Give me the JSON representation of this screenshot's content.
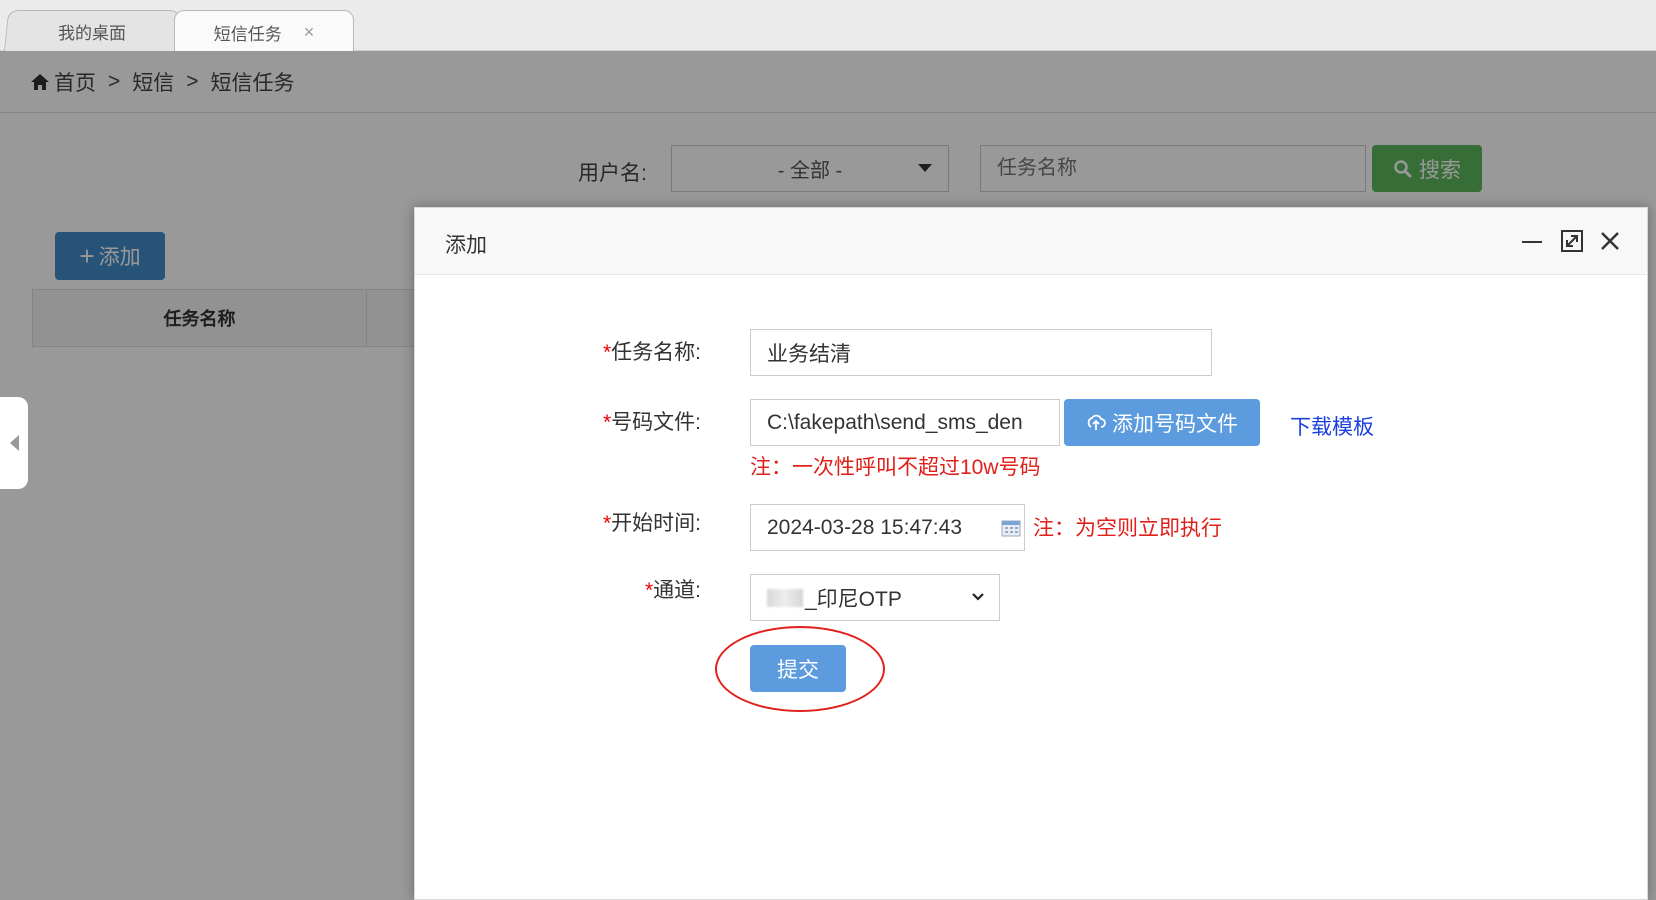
{
  "tabs": [
    {
      "label": "我的桌面",
      "closable": false
    },
    {
      "label": "短信任务",
      "closable": true,
      "close_glyph": "×"
    }
  ],
  "breadcrumb": {
    "home": "首页",
    "separator": ">",
    "items": [
      "短信",
      "短信任务"
    ]
  },
  "filter": {
    "username_label": "用户名:",
    "username_value": "- 全部 -",
    "task_name_placeholder": "任务名称",
    "search_label": "搜索"
  },
  "toolbar": {
    "add_label": "添加",
    "add_glyph": "+"
  },
  "table": {
    "columns": [
      "任务名称"
    ]
  },
  "modal": {
    "title": "添加",
    "form": {
      "required_mark": "*",
      "task_name_label": "任务名称:",
      "task_name_value": "业务结清",
      "number_file_label": "号码文件:",
      "number_file_value": "C:\\fakepath\\send_sms_den",
      "add_file_button": "添加号码文件",
      "download_template_link": "下载模板",
      "number_file_note": "注：一次性呼叫不超过10w号码",
      "start_time_label": "开始时间:",
      "start_time_value": "2024-03-28 15:47:43",
      "start_time_note": "注：为空则立即执行",
      "channel_label": "通道:",
      "channel_value": "_印尼OTP",
      "submit_label": "提交"
    }
  },
  "colors": {
    "primary_blue": "#5b9bde",
    "search_green": "#5cb85c",
    "note_red": "#e0201a",
    "link_blue": "#1a3fe0"
  }
}
